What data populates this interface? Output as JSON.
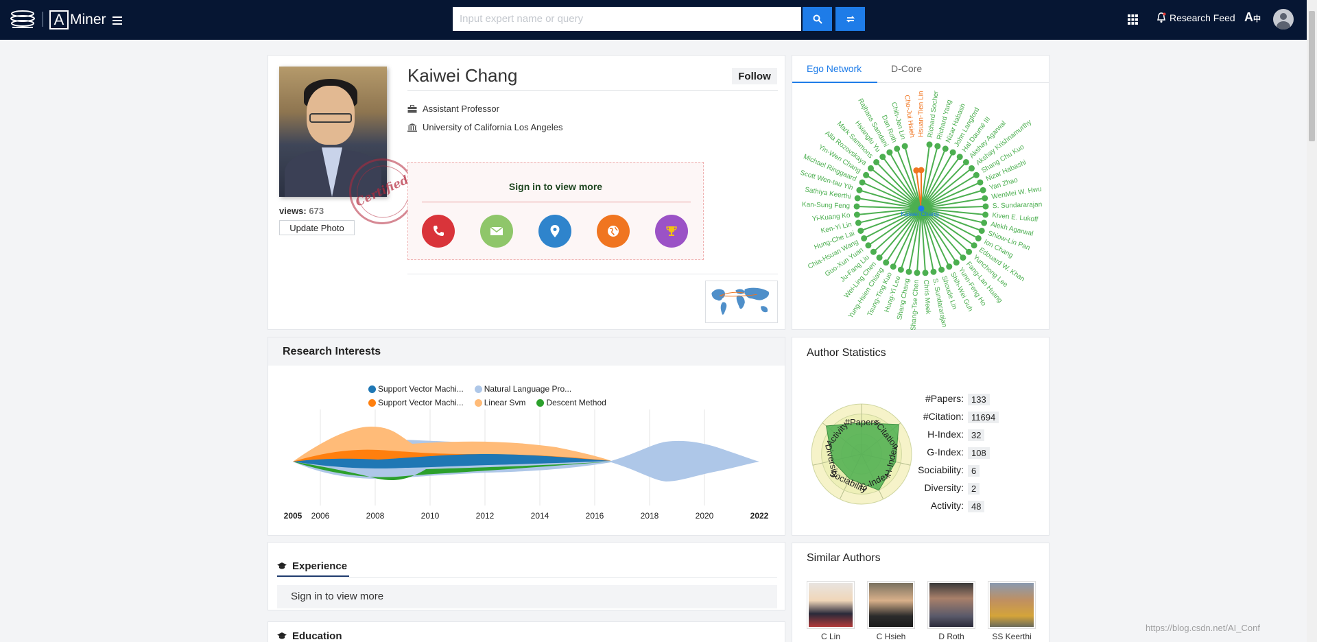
{
  "header": {
    "search_placeholder": "Input expert name or query",
    "research_feed": "Research Feed",
    "translate_label": "A"
  },
  "profile": {
    "name": "Kaiwei Chang",
    "follow": "Follow",
    "title": "Assistant Professor",
    "affiliation": "University of California Los Angeles",
    "views_label": "views:",
    "views": "673",
    "update_photo": "Update Photo",
    "stamp_text": "Certified",
    "sign_in_text": "Sign in to view more"
  },
  "ego": {
    "tabs": [
      "Ego Network",
      "D-Core"
    ],
    "center": "Kaiwei Chang",
    "highlight": [
      "Hsuan-Tien Lin",
      "Cho-Jui Hsieh"
    ],
    "nodes": [
      "Hsuan-Tien Lin",
      "Richard Socher",
      "Richard Yang",
      "Nizar Habash",
      "John Langford",
      "Hal Daumé III",
      "Akshay Agarwal",
      "Akshay Krishnamurthy",
      "Shang Chu Kuo",
      "Nizar Habashi",
      "Yan Zhao",
      "WenMei W. Hwu",
      "S. Sundararajan",
      "Kiven E. Lukoff",
      "Alekh Agarwal",
      "Shiow-Lin Pan",
      "Ion Chang",
      "Edouard W. Khan",
      "Yunchong Lee",
      "Fang-Lan Huang",
      "Yunn-Feng Ho",
      "Shih-Wei Guh",
      "Shoude Lin",
      "S. Sundararajan",
      "Chris Meek",
      "Shang-Tse Chen",
      "Shang Chang",
      "Hung-Yi Lee",
      "Tsung-Ting Kuo",
      "Yung-Hsien Chiang",
      "Wei-Ling Chen",
      "Ju-Fang Liu",
      "Guo-Xun Yuan",
      "Chia-Hsuan Wang",
      "Hung-Che Lai",
      "Ken-Yi Lin",
      "Yi-Kuang Ko",
      "Kan-Sung Feng",
      "Sathiya Keerthi",
      "Scott Wen-tau Yih",
      "Michael Ringgaard",
      "Yin-Wen Chang",
      "Alla Rozovskaya",
      "Mark Sammons",
      "Hsiangfu Yu",
      "Rajhans Samdani",
      "Dan Roth",
      "Chih-Jen Lin",
      "Cho-Jui Hsieh"
    ]
  },
  "research_interests": {
    "title": "Research Interests",
    "legend": [
      {
        "label": "Support Vector Machi...",
        "color": "#1f77b4"
      },
      {
        "label": "Natural Language Pro...",
        "color": "#aec7e8"
      },
      {
        "label": "Support Vector Machi...",
        "color": "#ff7f0e"
      },
      {
        "label": "Linear Svm",
        "color": "#ffbb78"
      },
      {
        "label": "Descent Method",
        "color": "#2ca02c"
      }
    ],
    "years": [
      "2005",
      "2006",
      "2008",
      "2010",
      "2012",
      "2014",
      "2016",
      "2018",
      "2020",
      "2022"
    ]
  },
  "stats": {
    "title": "Author Statistics",
    "items": [
      {
        "label": "#Papers:",
        "value": "133"
      },
      {
        "label": "#Citation:",
        "value": "11694"
      },
      {
        "label": "H-Index:",
        "value": "32"
      },
      {
        "label": "G-Index:",
        "value": "108"
      },
      {
        "label": "Sociability:",
        "value": "6"
      },
      {
        "label": "Diversity:",
        "value": "2"
      },
      {
        "label": "Activity:",
        "value": "48"
      }
    ],
    "radar_axes": [
      "#Papers",
      "#Citation",
      "H-Index",
      "G-Index",
      "Sociability",
      "Diversity",
      "Activity"
    ]
  },
  "experience": {
    "title": "Experience",
    "signin": "Sign in to view more"
  },
  "education": {
    "title": "Education"
  },
  "similar": {
    "title": "Similar Authors",
    "authors": [
      "C Lin",
      "C Hsieh",
      "D Roth",
      "SS Keerthi"
    ]
  },
  "watermark": "https://blog.csdn.net/AI_Conf"
}
